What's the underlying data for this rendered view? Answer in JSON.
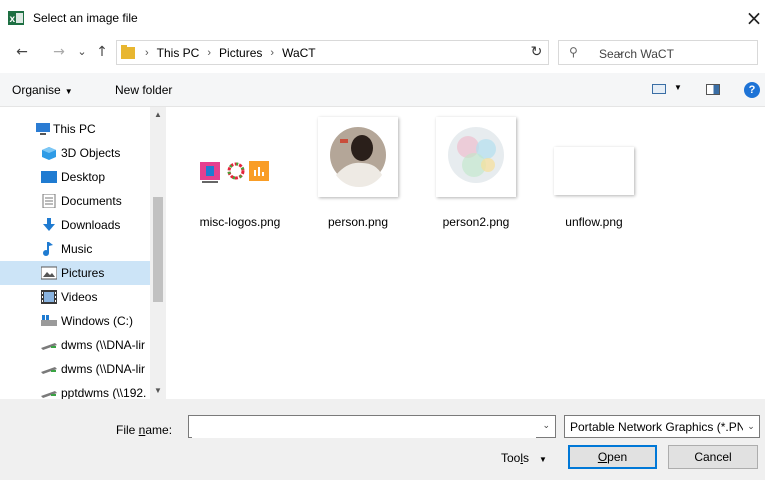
{
  "window": {
    "title": "Select an image file",
    "close_glyph": "×"
  },
  "nav": {
    "back_glyph": "←",
    "forward_glyph": "→",
    "recent_glyph": "⌄",
    "up_glyph": "↑"
  },
  "address": {
    "crumbs": [
      "This PC",
      "Pictures",
      "WaCT"
    ],
    "separator": "›",
    "refresh_glyph": "↻"
  },
  "search": {
    "placeholder": "Search WaCT",
    "icon_glyph": "⚲"
  },
  "toolbar": {
    "organise_label": "Organise",
    "new_folder_label": "New folder",
    "help_glyph": "?"
  },
  "sidebar": {
    "items": [
      {
        "label": "This PC",
        "icon": "this-pc-icon"
      },
      {
        "label": "3D Objects",
        "icon": "3d-objects-icon"
      },
      {
        "label": "Desktop",
        "icon": "desktop-icon"
      },
      {
        "label": "Documents",
        "icon": "documents-icon"
      },
      {
        "label": "Downloads",
        "icon": "downloads-icon"
      },
      {
        "label": "Music",
        "icon": "music-icon"
      },
      {
        "label": "Pictures",
        "icon": "pictures-icon",
        "selected": true
      },
      {
        "label": "Videos",
        "icon": "videos-icon"
      },
      {
        "label": "Windows (C:)",
        "icon": "drive-icon"
      },
      {
        "label": "dwms (\\\\DNA-lir",
        "icon": "network-drive-icon"
      },
      {
        "label": "dwms (\\\\DNA-lir",
        "icon": "network-drive-icon"
      },
      {
        "label": "pptdwms (\\\\192.",
        "icon": "network-drive-icon"
      }
    ]
  },
  "files": [
    {
      "name": "misc-logos.png"
    },
    {
      "name": "person.png"
    },
    {
      "name": "person2.png"
    },
    {
      "name": "unflow.png"
    }
  ],
  "footer": {
    "file_name_label_pre": "File ",
    "file_name_label_accel": "n",
    "file_name_label_post": "ame:",
    "file_name_value": "",
    "file_type": "Portable Network Graphics (*.PN",
    "tools_label_pre": "Too",
    "tools_label_accel": "l",
    "tools_label_post": "s",
    "open_label_accel": "O",
    "open_label_post": "pen",
    "cancel_label": "Cancel"
  },
  "colors": {
    "accent": "#0078d7",
    "selection": "#cce4f7",
    "folder": "#e8b630"
  }
}
